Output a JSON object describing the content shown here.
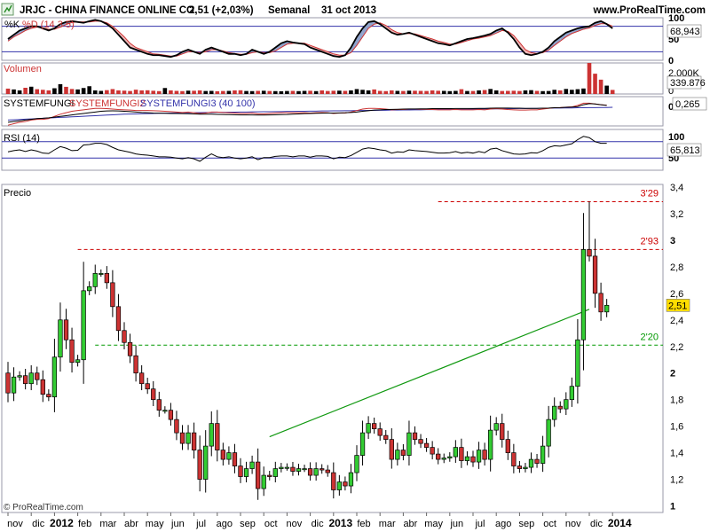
{
  "header": {
    "symbol_title": "JRJC - CHINA FINANCE ONLINE CO.",
    "last": "2,51 (+2,03%)",
    "period": "Semanal",
    "date": "31 oct 2013",
    "site": "www.ProRealTime.com"
  },
  "footer": {
    "copyright": "© ProRealTime.com"
  },
  "colors": {
    "up": "#33cc33",
    "down": "#cc3333",
    "outline": "#000000",
    "frame": "#9999aa",
    "grid_band": "#3333aa",
    "level_red": "#cc0000",
    "level_green": "#009900",
    "trend": "#119911",
    "price_badge": "#ffdd00"
  },
  "chart_data": [
    {
      "type": "candlestick",
      "panel": "price",
      "title": "Precio",
      "y_ticks": [
        1,
        1.2,
        1.4,
        1.6,
        1.8,
        2,
        2.2,
        2.4,
        2.6,
        2.8,
        3,
        3.2,
        3.4
      ],
      "y_tick_labels": [
        "1",
        "1,2",
        "1,4",
        "1,6",
        "1,8",
        "2",
        "2,2",
        "2,4",
        "2,6",
        "2,8",
        "3",
        "3,2",
        "3,4"
      ],
      "ylim": [
        0.95,
        3.42
      ],
      "last_price_label": "2,51",
      "last_price": 2.51,
      "levels": [
        {
          "label": "3'29",
          "value": 3.29,
          "color": "red",
          "from_week": 74
        },
        {
          "label": "2'93",
          "value": 2.93,
          "color": "red",
          "from_week": 12
        },
        {
          "label": "2'20",
          "value": 2.21,
          "color": "green",
          "from_week": 15
        }
      ],
      "trendline": {
        "from": [
          45,
          1.52
        ],
        "to": [
          100,
          2.48
        ]
      },
      "close": [
        1.85,
        1.97,
        1.98,
        1.92,
        2.0,
        1.95,
        1.84,
        1.82,
        2.12,
        2.4,
        2.25,
        2.08,
        2.1,
        2.62,
        2.65,
        2.75,
        2.75,
        2.68,
        2.5,
        2.32,
        2.23,
        2.13,
        2.0,
        1.92,
        1.88,
        1.8,
        1.72,
        1.72,
        1.65,
        1.55,
        1.47,
        1.55,
        1.42,
        1.2,
        1.45,
        1.62,
        1.42,
        1.35,
        1.4,
        1.3,
        1.22,
        1.28,
        1.33,
        1.13,
        1.23,
        1.22,
        1.28,
        1.29,
        1.29,
        1.26,
        1.28,
        1.28,
        1.23,
        1.28,
        1.27,
        1.25,
        1.12,
        1.18,
        1.15,
        1.25,
        1.38,
        1.55,
        1.62,
        1.58,
        1.53,
        1.5,
        1.35,
        1.42,
        1.38,
        1.55,
        1.5,
        1.47,
        1.44,
        1.39,
        1.35,
        1.36,
        1.37,
        1.44,
        1.34,
        1.37,
        1.33,
        1.42,
        1.35,
        1.57,
        1.62,
        1.5,
        1.4,
        1.3,
        1.28,
        1.29,
        1.35,
        1.32,
        1.45,
        1.65,
        1.75,
        1.73,
        1.8,
        1.9,
        2.25,
        2.93,
        2.88,
        2.6,
        2.46,
        2.51
      ],
      "open": [
        2.0,
        1.85,
        1.97,
        1.98,
        1.92,
        2.0,
        1.95,
        1.84,
        1.82,
        2.12,
        2.4,
        2.25,
        2.08,
        2.1,
        2.62,
        2.65,
        2.75,
        2.75,
        2.68,
        2.5,
        2.32,
        2.23,
        2.13,
        2.0,
        1.92,
        1.88,
        1.8,
        1.72,
        1.72,
        1.65,
        1.55,
        1.47,
        1.55,
        1.42,
        1.2,
        1.45,
        1.62,
        1.42,
        1.35,
        1.4,
        1.3,
        1.22,
        1.28,
        1.33,
        1.13,
        1.23,
        1.22,
        1.28,
        1.29,
        1.29,
        1.26,
        1.28,
        1.28,
        1.23,
        1.28,
        1.27,
        1.25,
        1.12,
        1.18,
        1.15,
        1.25,
        1.38,
        1.55,
        1.62,
        1.58,
        1.53,
        1.5,
        1.35,
        1.42,
        1.38,
        1.55,
        1.5,
        1.47,
        1.44,
        1.39,
        1.35,
        1.36,
        1.37,
        1.44,
        1.34,
        1.37,
        1.33,
        1.42,
        1.35,
        1.57,
        1.62,
        1.5,
        1.4,
        1.3,
        1.28,
        1.29,
        1.35,
        1.32,
        1.45,
        1.65,
        1.75,
        1.73,
        1.8,
        1.9,
        2.25,
        2.93,
        2.88,
        2.6,
        2.46
      ],
      "x_labels": [
        {
          "week": 0,
          "label": "nov"
        },
        {
          "week": 4,
          "label": "dic"
        },
        {
          "week": 8,
          "label": "2012",
          "bold": true
        },
        {
          "week": 12,
          "label": "feb"
        },
        {
          "week": 16,
          "label": "mar"
        },
        {
          "week": 20,
          "label": "abr"
        },
        {
          "week": 24,
          "label": "may"
        },
        {
          "week": 28,
          "label": "jun"
        },
        {
          "week": 32,
          "label": "jul"
        },
        {
          "week": 36,
          "label": "ago"
        },
        {
          "week": 40,
          "label": "sep"
        },
        {
          "week": 44,
          "label": "oct"
        },
        {
          "week": 48,
          "label": "nov"
        },
        {
          "week": 52,
          "label": "dic"
        },
        {
          "week": 56,
          "label": "2013",
          "bold": true
        },
        {
          "week": 60,
          "label": "feb"
        },
        {
          "week": 64,
          "label": "mar"
        },
        {
          "week": 68,
          "label": "abr"
        },
        {
          "week": 72,
          "label": "may"
        },
        {
          "week": 76,
          "label": "jun"
        },
        {
          "week": 80,
          "label": "jul"
        },
        {
          "week": 84,
          "label": "ago"
        },
        {
          "week": 88,
          "label": "sep"
        },
        {
          "week": 92,
          "label": "oct"
        },
        {
          "week": 96,
          "label": "nov"
        },
        {
          "week": 100,
          "label": "dic"
        },
        {
          "week": 104,
          "label": "2014",
          "bold": true
        }
      ]
    },
    {
      "type": "line",
      "panel": "stochastic",
      "title_k": "%K",
      "title_d": "%D (14 3 5)",
      "y_ticks": [
        0,
        50,
        100
      ],
      "y_tick_labels": [
        "0",
        "50",
        "100"
      ],
      "bands": [
        20,
        80
      ],
      "last_label": "68,943",
      "ylim": [
        0,
        100
      ],
      "k": [
        50,
        60,
        70,
        75,
        80,
        80,
        75,
        70,
        75,
        85,
        90,
        92,
        90,
        88,
        92,
        95,
        92,
        85,
        75,
        60,
        45,
        30,
        25,
        20,
        15,
        12,
        12,
        10,
        8,
        12,
        20,
        25,
        20,
        15,
        25,
        30,
        25,
        20,
        15,
        15,
        12,
        15,
        25,
        20,
        15,
        20,
        30,
        40,
        45,
        42,
        40,
        38,
        30,
        25,
        20,
        15,
        10,
        8,
        12,
        30,
        55,
        75,
        90,
        92,
        85,
        75,
        65,
        60,
        62,
        65,
        60,
        55,
        50,
        45,
        40,
        38,
        35,
        40,
        45,
        50,
        52,
        55,
        58,
        62,
        70,
        75,
        65,
        50,
        30,
        15,
        12,
        15,
        20,
        30,
        45,
        55,
        65,
        70,
        75,
        78,
        80,
        88,
        92,
        85,
        75
      ],
      "d": [
        45,
        55,
        62,
        70,
        75,
        78,
        76,
        73,
        73,
        78,
        84,
        89,
        90,
        90,
        90,
        92,
        92,
        88,
        80,
        68,
        55,
        40,
        30,
        25,
        20,
        15,
        14,
        12,
        10,
        10,
        15,
        20,
        20,
        18,
        20,
        25,
        25,
        22,
        18,
        16,
        14,
        14,
        18,
        20,
        18,
        18,
        22,
        30,
        38,
        40,
        40,
        40,
        35,
        30,
        25,
        20,
        15,
        12,
        12,
        18,
        35,
        55,
        75,
        85,
        88,
        82,
        72,
        65,
        62,
        63,
        62,
        58,
        54,
        50,
        45,
        42,
        38,
        38,
        42,
        46,
        50,
        52,
        55,
        58,
        64,
        70,
        68,
        58,
        42,
        25,
        18,
        16,
        18,
        24,
        35,
        45,
        55,
        63,
        68,
        73,
        76,
        82,
        86,
        86,
        80
      ]
    },
    {
      "type": "bar",
      "panel": "volume",
      "title": "Volumen",
      "y_tick_labels": [
        "2.000K",
        "0"
      ],
      "last_label": "339.876",
      "ylim": [
        0,
        2600
      ],
      "values": [
        450,
        380,
        300,
        520,
        610,
        400,
        350,
        300,
        480,
        820,
        600,
        420,
        380,
        500,
        650,
        300,
        260,
        320,
        410,
        300,
        280,
        250,
        360,
        300,
        310,
        270,
        240,
        500,
        300,
        260,
        240,
        280,
        270,
        300,
        250,
        260,
        230,
        250,
        260,
        300,
        310,
        250,
        240,
        260,
        270,
        250,
        240,
        230,
        250,
        260,
        240,
        260,
        270,
        240,
        300,
        250,
        270,
        280,
        260,
        300,
        410,
        350,
        300,
        380,
        260,
        240,
        300,
        260,
        250,
        280,
        270,
        260,
        250,
        300,
        270,
        260,
        240,
        260,
        400,
        250,
        250,
        300,
        330,
        420,
        300,
        250,
        260,
        270,
        250,
        300,
        320,
        260,
        240,
        250,
        350,
        300,
        420,
        350,
        400,
        460,
        2600,
        1700,
        1200,
        700,
        340
      ]
    },
    {
      "type": "line",
      "panel": "systemfungi",
      "title_1": "SYSTEMFUNGI",
      "title_2": "SYSTEMFUNGI2",
      "title_3": "SYSTEMFUNGI3 (40 100)",
      "y_tick_labels": [
        "0"
      ],
      "last_label": "0,265",
      "ylim": [
        -1,
        1
      ],
      "s1": [
        -0.75,
        -0.7,
        -0.65,
        -0.6,
        -0.55,
        -0.5,
        -0.48,
        -0.45,
        -0.4,
        -0.35,
        -0.3,
        -0.25,
        -0.2,
        -0.15,
        -0.1,
        -0.05,
        0,
        0.02,
        0.03,
        0.02,
        0,
        -0.02,
        -0.05,
        -0.08,
        -0.1,
        -0.12,
        -0.13,
        -0.14,
        -0.15,
        -0.15,
        -0.16,
        -0.17,
        -0.18,
        -0.2,
        -0.2,
        -0.2,
        -0.21,
        -0.22,
        -0.23,
        -0.24,
        -0.25,
        -0.25,
        -0.25,
        -0.26,
        -0.26,
        -0.25,
        -0.24,
        -0.23,
        -0.22,
        -0.2,
        -0.18,
        -0.16,
        -0.15,
        -0.14,
        -0.13,
        -0.12,
        -0.12,
        -0.11,
        -0.1,
        -0.08,
        -0.05,
        0,
        0.04,
        0.08,
        0.1,
        0.12,
        0.13,
        0.14,
        0.15,
        0.16,
        0.16,
        0.17,
        0.17,
        0.18,
        0.18,
        0.18,
        0.18,
        0.19,
        0.19,
        0.19,
        0.19,
        0.2,
        0.2,
        0.21,
        0.22,
        0.22,
        0.22,
        0.21,
        0.21,
        0.2,
        0.2,
        0.2,
        0.21,
        0.22,
        0.24,
        0.25,
        0.27,
        0.29,
        0.32,
        0.45,
        0.52,
        0.5,
        0.45,
        0.4
      ],
      "s2": [
        -0.95,
        -0.85,
        -0.75,
        -0.7,
        -0.6,
        -0.55,
        -0.55,
        -0.5,
        -0.35,
        -0.2,
        -0.1,
        0,
        0.05,
        0.1,
        0.15,
        0.2,
        0.2,
        0.18,
        0.15,
        0.12,
        0.1,
        0.08,
        0.05,
        0.05,
        0.05,
        0.04,
        0.02,
        0,
        -0.02,
        -0.05,
        -0.08,
        -0.05,
        -0.1,
        -0.15,
        -0.12,
        -0.05,
        -0.05,
        -0.08,
        -0.1,
        -0.12,
        -0.15,
        -0.15,
        -0.12,
        -0.18,
        -0.18,
        -0.15,
        -0.12,
        -0.1,
        -0.1,
        -0.1,
        -0.1,
        -0.1,
        -0.12,
        -0.1,
        -0.08,
        -0.1,
        -0.15,
        -0.12,
        -0.12,
        -0.05,
        0.05,
        0.15,
        0.2,
        0.2,
        0.18,
        0.15,
        0.1,
        0.12,
        0.12,
        0.15,
        0.15,
        0.14,
        0.13,
        0.12,
        0.1,
        0.1,
        0.1,
        0.12,
        0.1,
        0.1,
        0.1,
        0.12,
        0.1,
        0.15,
        0.18,
        0.15,
        0.12,
        0.1,
        0.08,
        0.08,
        0.1,
        0.1,
        0.15,
        0.2,
        0.25,
        0.25,
        0.28,
        0.3,
        0.4,
        0.55,
        0.55,
        0.5,
        0.45,
        0.42
      ],
      "s3": [
        -0.6,
        -0.58,
        -0.56,
        -0.54,
        -0.52,
        -0.5,
        -0.48,
        -0.46,
        -0.44,
        -0.42,
        -0.4,
        -0.38,
        -0.36,
        -0.34,
        -0.32,
        -0.3,
        -0.28,
        -0.26,
        -0.24,
        -0.22,
        -0.2,
        -0.19,
        -0.18,
        -0.17,
        -0.16,
        -0.15,
        -0.14,
        -0.13,
        -0.12,
        -0.11,
        -0.1,
        -0.1,
        -0.09,
        -0.09,
        -0.08,
        -0.08,
        -0.07,
        -0.07,
        -0.06,
        -0.06,
        -0.05,
        -0.05,
        -0.04,
        -0.04,
        -0.03,
        -0.03,
        -0.02,
        -0.02,
        -0.01,
        -0.01,
        0,
        0,
        0.01,
        0.01,
        0.02,
        0.02,
        0.03,
        0.03,
        0.04,
        0.04,
        0.05,
        0.05,
        0.06,
        0.06,
        0.07,
        0.07,
        0.08,
        0.08,
        0.09,
        0.09,
        0.1,
        0.1,
        0.11,
        0.11,
        0.12,
        0.12,
        0.13,
        0.13,
        0.14,
        0.14,
        0.15,
        0.15,
        0.16,
        0.16,
        0.17,
        0.17,
        0.18,
        0.18,
        0.19,
        0.19,
        0.2,
        0.2,
        0.21,
        0.21,
        0.22,
        0.22,
        0.23,
        0.23,
        0.24,
        0.24,
        0.25,
        0.25,
        0.26,
        0.26,
        0.27
      ]
    },
    {
      "type": "line",
      "panel": "rsi",
      "title": "RSI (14)",
      "y_ticks": [
        50,
        100
      ],
      "y_tick_labels": [
        "50",
        "100"
      ],
      "bands": [
        30,
        70
      ],
      "last_label": "65,813",
      "ylim": [
        0,
        100
      ],
      "values": [
        45,
        48,
        50,
        46,
        50,
        47,
        42,
        41,
        50,
        58,
        54,
        48,
        49,
        62,
        63,
        66,
        66,
        63,
        56,
        50,
        47,
        44,
        40,
        38,
        37,
        35,
        33,
        33,
        32,
        30,
        28,
        31,
        28,
        22,
        32,
        40,
        33,
        31,
        33,
        30,
        28,
        30,
        33,
        26,
        31,
        31,
        34,
        35,
        35,
        33,
        35,
        35,
        32,
        35,
        35,
        34,
        28,
        32,
        31,
        36,
        44,
        52,
        55,
        53,
        50,
        48,
        42,
        45,
        44,
        50,
        48,
        47,
        46,
        44,
        42,
        42,
        43,
        46,
        42,
        44,
        42,
        46,
        43,
        52,
        54,
        48,
        44,
        40,
        39,
        40,
        43,
        42,
        48,
        56,
        60,
        59,
        62,
        65,
        75,
        83,
        80,
        70,
        66,
        66
      ]
    }
  ]
}
